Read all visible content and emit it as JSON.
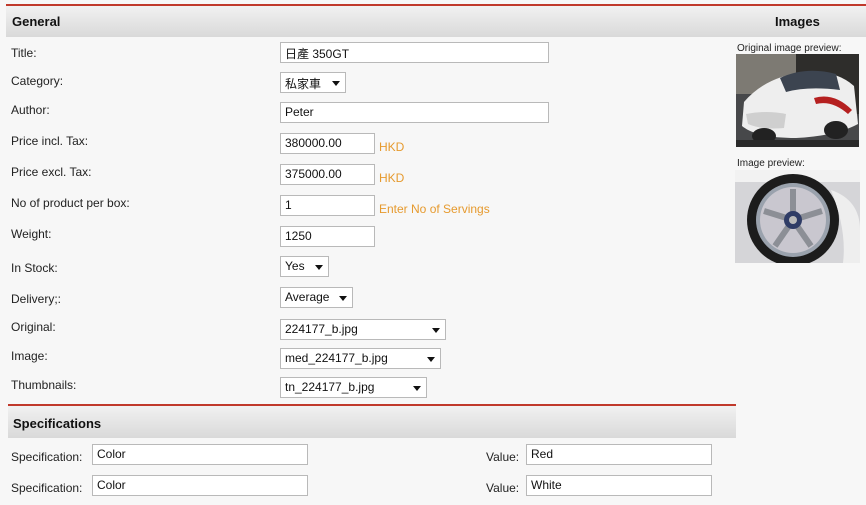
{
  "general": {
    "title": "General",
    "fields": {
      "title": {
        "label": "Title:",
        "value": "日產 350GT"
      },
      "category": {
        "label": "Category:",
        "value": "私家車"
      },
      "author": {
        "label": "Author:",
        "value": "Peter"
      },
      "price_incl": {
        "label": "Price incl. Tax:",
        "value": "380000.00",
        "unit": "HKD"
      },
      "price_excl": {
        "label": "Price excl. Tax:",
        "value": "375000.00",
        "unit": "HKD"
      },
      "per_box": {
        "label": "No of product per box:",
        "value": "1",
        "hint": "Enter No of Servings"
      },
      "weight": {
        "label": "Weight:",
        "value": "1250"
      },
      "in_stock": {
        "label": "In Stock:",
        "value": "Yes"
      },
      "delivery": {
        "label": "Delivery;:",
        "value": "Average"
      },
      "original": {
        "label": "Original:",
        "value": "224177_b.jpg"
      },
      "image": {
        "label": "Image:",
        "value": "med_224177_b.jpg"
      },
      "thumbnails": {
        "label": "Thumbnails:",
        "value": "tn_224177_b.jpg"
      }
    }
  },
  "images": {
    "title": "Images",
    "original_caption": "Original image preview:",
    "image_caption": "Image preview:"
  },
  "specifications": {
    "title": "Specifications",
    "spec_label": "Specification:",
    "value_label": "Value:",
    "rows": [
      {
        "spec": "Color",
        "value": "Red"
      },
      {
        "spec": "Color",
        "value": "White"
      }
    ]
  },
  "colors": {
    "accent_red": "#c0392b",
    "hint_orange": "#e69a2e"
  }
}
